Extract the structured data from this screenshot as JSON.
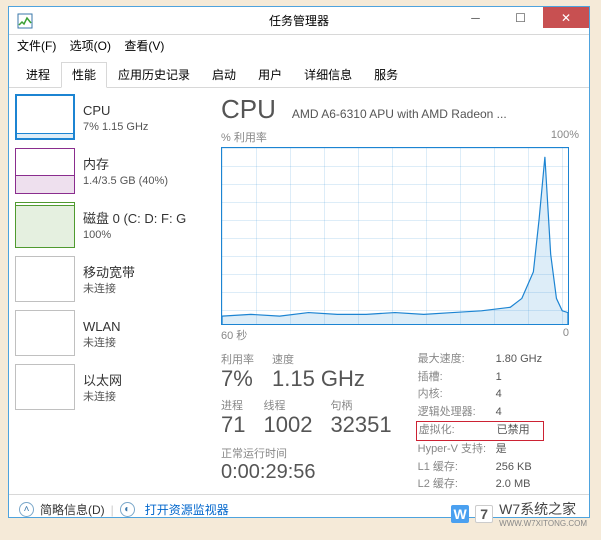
{
  "window": {
    "title": "任务管理器",
    "menu": {
      "file": "文件(F)",
      "options": "选项(O)",
      "view": "查看(V)"
    },
    "tabs": [
      "进程",
      "性能",
      "应用历史记录",
      "启动",
      "用户",
      "详细信息",
      "服务"
    ],
    "active_tab_index": 1
  },
  "sidebar": {
    "items": [
      {
        "title": "CPU",
        "sub": "7% 1.15 GHz"
      },
      {
        "title": "内存",
        "sub": "1.4/3.5 GB (40%)"
      },
      {
        "title": "磁盘 0 (C: D: F: G",
        "sub": "100%"
      },
      {
        "title": "移动宽带",
        "sub": "未连接"
      },
      {
        "title": "WLAN",
        "sub": "未连接"
      },
      {
        "title": "以太网",
        "sub": "未连接"
      }
    ],
    "selected_index": 0
  },
  "main": {
    "title": "CPU",
    "subtitle": "AMD A6-6310 APU with AMD Radeon ...",
    "util_label": "% 利用率",
    "util_max": "100%",
    "axis_left": "60 秒",
    "axis_right": "0",
    "stats": {
      "util_label": "利用率",
      "util": "7%",
      "speed_label": "速度",
      "speed": "1.15 GHz",
      "proc_label": "进程",
      "proc": "71",
      "threads_label": "线程",
      "threads": "1002",
      "handles_label": "句柄",
      "handles": "32351"
    },
    "kv": {
      "max_speed_k": "最大速度:",
      "max_speed_v": "1.80 GHz",
      "sockets_k": "插槽:",
      "sockets_v": "1",
      "cores_k": "内核:",
      "cores_v": "4",
      "lproc_k": "逻辑处理器:",
      "lproc_v": "4",
      "virt_k": "虚拟化:",
      "virt_v": "已禁用",
      "hyperv_k": "Hyper-V 支持:",
      "hyperv_v": "是",
      "l1_k": "L1 缓存:",
      "l1_v": "256 KB",
      "l2_k": "L2 缓存:",
      "l2_v": "2.0 MB"
    },
    "uptime_label": "正常运行时间",
    "uptime": "0:00:29:56"
  },
  "footer": {
    "brief": "简略信息(D)",
    "resmon": "打开资源监视器"
  },
  "watermark": {
    "text": "W7系统之家",
    "sub": "WWW.W7XITONG.COM"
  },
  "chart_data": {
    "type": "line",
    "title": "CPU % 利用率",
    "xlabel": "秒",
    "ylabel": "% 利用率",
    "xlim": [
      60,
      0
    ],
    "ylim": [
      0,
      100
    ],
    "x": [
      60,
      55,
      50,
      45,
      40,
      35,
      30,
      25,
      20,
      15,
      10,
      8,
      6,
      5,
      4,
      3,
      2,
      1,
      0
    ],
    "values": [
      5,
      6,
      5,
      7,
      6,
      6,
      7,
      6,
      7,
      8,
      10,
      15,
      30,
      60,
      95,
      40,
      15,
      8,
      7
    ]
  }
}
